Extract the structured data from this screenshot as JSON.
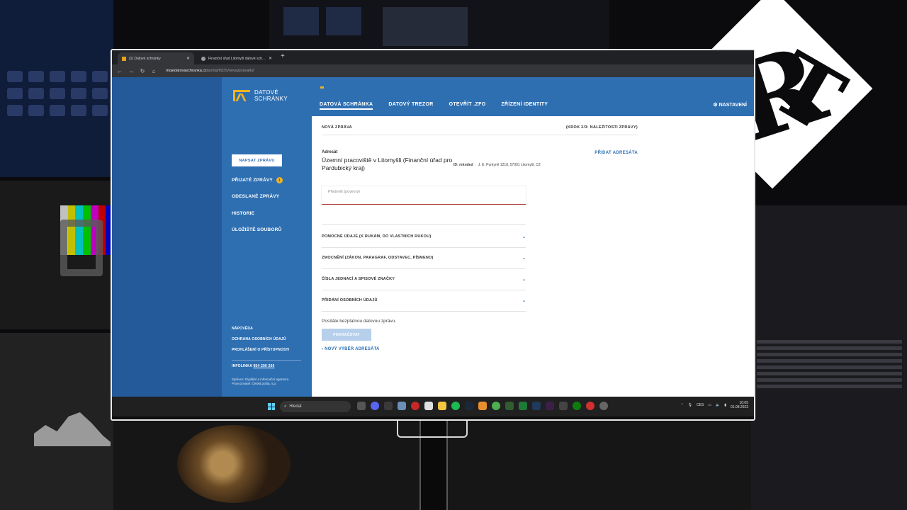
{
  "browser": {
    "tabs": [
      {
        "label": "(1) Datové schránky"
      },
      {
        "label": "Finanční úřad Litomyšl datové sch…"
      }
    ],
    "url_host": "mojedatovaschranka.cz",
    "url_path": "/portal/ISDS/novazprava/k2"
  },
  "header": {
    "brand_line1": "DATOVÉ",
    "brand_line2": "SCHRÁNKY",
    "nav": [
      "DATOVÁ SCHRÁNKA",
      "DATOVÝ TREZOR",
      "OTEVŘÍT .ZFO",
      "ZŘÍZENÍ IDENTITY"
    ],
    "settings": "NASTAVENÍ"
  },
  "sidebar": {
    "compose": "NAPSAT ZPRÁVU",
    "items": [
      {
        "label": "PŘIJATÉ ZPRÁVY",
        "badge": "1"
      },
      {
        "label": "ODESLANÉ ZPRÁVY"
      },
      {
        "label": "HISTORIE"
      },
      {
        "label": "ÚLOŽIŠTĚ SOUBORŮ"
      }
    ],
    "footer": [
      "NÁPOVĚDA",
      "OCHRANA OSOBNÍCH ÚDAJŮ",
      "PROHLÁŠENÍ O PŘÍSTUPNOSTI"
    ],
    "infoline_label": "INFOLINKA",
    "infoline_number": "954 200 200",
    "operator_line1": "Správce: Digitální a informační agentura",
    "operator_line2": "Provozovatel: Česká pošta, s.p."
  },
  "main": {
    "crumb": "NOVÁ ZPRÁVA",
    "step": "(KROK 2/3: NÁLEŽITOSTI ZPRÁVY)",
    "recipient_label": "Adresát",
    "recipient_name": "Územní pracoviště v Litomyšli (Finanční úřad pro Pardubický kraj)",
    "recipient_id_label": "ID:",
    "recipient_id": "reknded",
    "recipient_address": "J. E. Purkyně 1218, 57001 Litomyšl, CZ",
    "add_recipient": "PŘIDAT ADRESÁTA",
    "subject_placeholder": "Předmět (povinný)",
    "sections": [
      "POMOCNÉ ÚDAJE (K RUKÁM, DO VLASTNÍCH RUKOU)",
      "ZMOCNĚNÍ (ZÁKON, PARAGRAF, ODSTAVEC, PÍSMENO)",
      "ČÍSLA JEDNACÍ A SPISOVÉ ZNAČKY",
      "PŘIDÁNÍ OSOBNÍCH ÚDAJŮ"
    ],
    "free_note": "Posíláte bezplatnou datovou zprávu.",
    "continue_button": "POKRAČOVAT",
    "back_link": "NOVÝ VÝBĚR ADRESÁTA"
  },
  "taskbar": {
    "search": "Hledat",
    "lang": "CES",
    "time": "10:05",
    "date": "01.08.2023"
  },
  "colors": {
    "primary": "#2e6fb2",
    "primary_dark": "#24599a",
    "accent": "#f0b323",
    "error": "#b23b3b"
  }
}
